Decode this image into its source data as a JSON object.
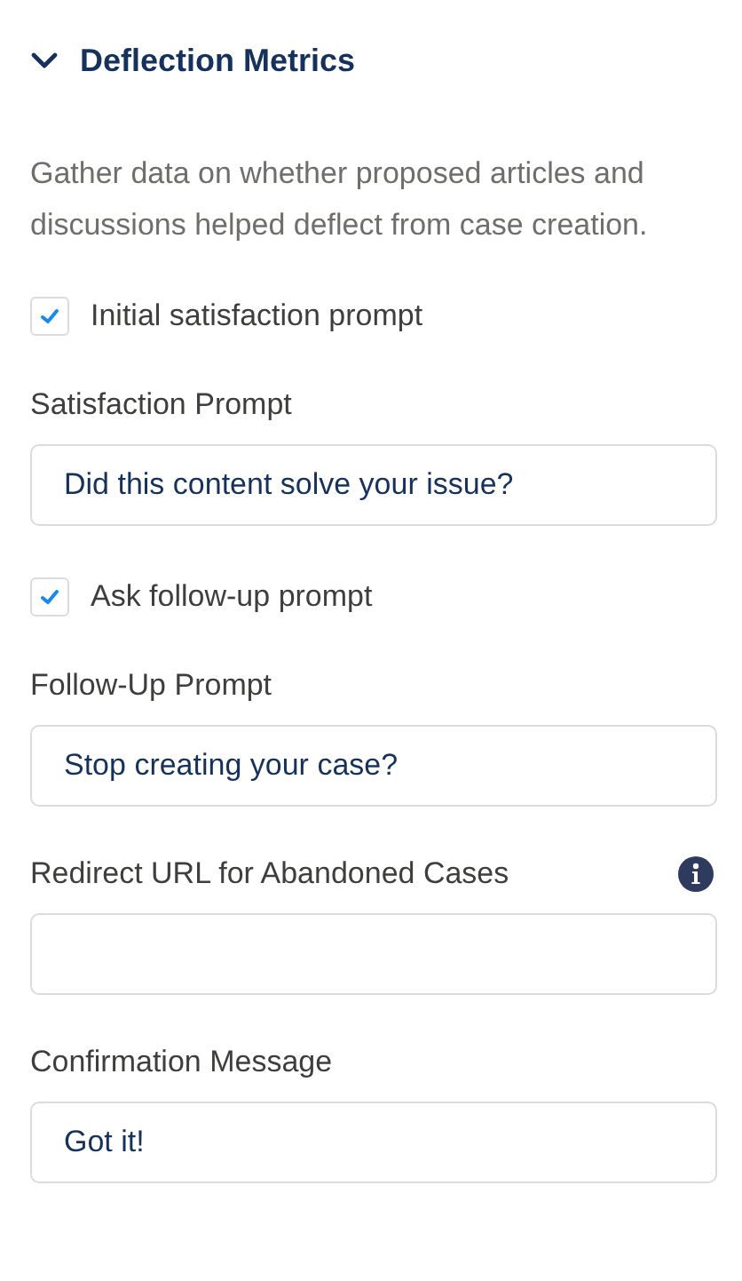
{
  "section": {
    "title": "Deflection Metrics",
    "expanded": true
  },
  "description": "Gather data on whether proposed articles and discussions helped deflect from case creation.",
  "items": [
    {
      "kind": "checkbox",
      "label": "Initial satisfaction prompt",
      "checked": true
    },
    {
      "kind": "field",
      "label": "Satisfaction Prompt",
      "value": "Did this content solve your issue?",
      "info": false
    },
    {
      "kind": "checkbox",
      "label": "Ask follow-up prompt",
      "checked": true
    },
    {
      "kind": "field",
      "label": "Follow-Up Prompt",
      "value": "Stop creating your case?",
      "info": false
    },
    {
      "kind": "field",
      "label": "Redirect URL for Abandoned Cases",
      "value": "",
      "info": true
    },
    {
      "kind": "field",
      "label": "Confirmation Message",
      "value": "Got it!",
      "info": false
    }
  ]
}
